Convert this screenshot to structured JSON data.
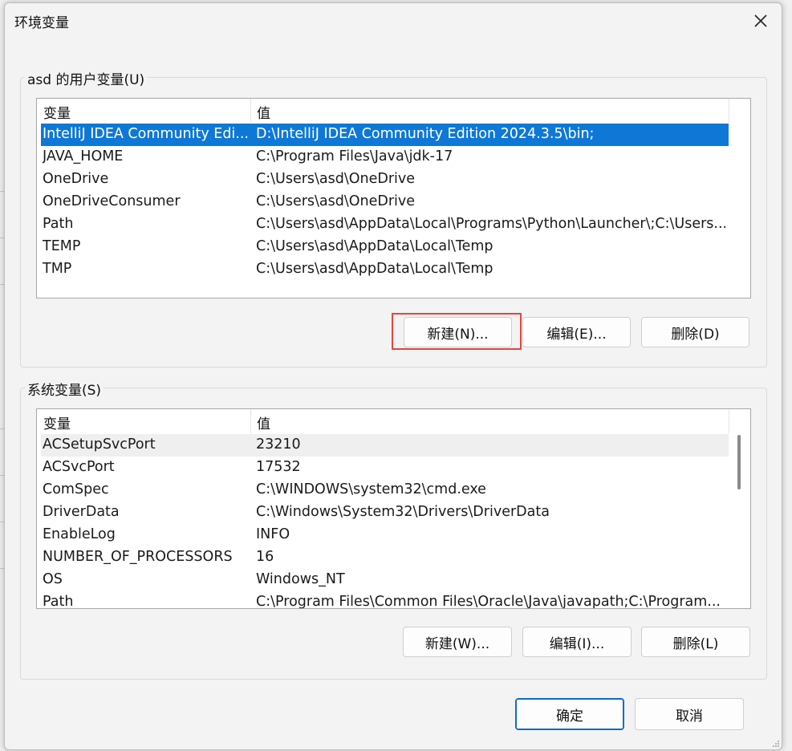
{
  "dialog": {
    "title": "环境变量",
    "close_icon": "close-icon"
  },
  "user_vars": {
    "group_label": "asd 的用户变量(U)",
    "col_name": "变量",
    "col_value": "值",
    "rows": [
      {
        "name": "IntelliJ IDEA Community Edi...",
        "value": "D:\\IntelliJ IDEA Community Edition 2024.3.5\\bin;"
      },
      {
        "name": "JAVA_HOME",
        "value": "C:\\Program Files\\Java\\jdk-17"
      },
      {
        "name": "OneDrive",
        "value": "C:\\Users\\asd\\OneDrive"
      },
      {
        "name": "OneDriveConsumer",
        "value": "C:\\Users\\asd\\OneDrive"
      },
      {
        "name": "Path",
        "value": "C:\\Users\\asd\\AppData\\Local\\Programs\\Python\\Launcher\\;C:\\Users..."
      },
      {
        "name": "TEMP",
        "value": "C:\\Users\\asd\\AppData\\Local\\Temp"
      },
      {
        "name": "TMP",
        "value": "C:\\Users\\asd\\AppData\\Local\\Temp"
      }
    ],
    "new_label": "新建(N)...",
    "edit_label": "编辑(E)...",
    "delete_label": "删除(D)"
  },
  "system_vars": {
    "group_label": "系统变量(S)",
    "col_name": "变量",
    "col_value": "值",
    "rows": [
      {
        "name": "ACSetupSvcPort",
        "value": "23210"
      },
      {
        "name": "ACSvcPort",
        "value": "17532"
      },
      {
        "name": "ComSpec",
        "value": "C:\\WINDOWS\\system32\\cmd.exe"
      },
      {
        "name": "DriverData",
        "value": "C:\\Windows\\System32\\Drivers\\DriverData"
      },
      {
        "name": "EnableLog",
        "value": "INFO"
      },
      {
        "name": "NUMBER_OF_PROCESSORS",
        "value": "16"
      },
      {
        "name": "OS",
        "value": "Windows_NT"
      },
      {
        "name": "Path",
        "value": "C:\\Program Files\\Common Files\\Oracle\\Java\\javapath;C:\\Program..."
      }
    ],
    "new_label": "新建(W)...",
    "edit_label": "编辑(I)...",
    "delete_label": "删除(L)"
  },
  "footer": {
    "ok_label": "确定",
    "cancel_label": "取消"
  },
  "colors": {
    "selection": "#0f78d7",
    "highlight_box": "#e0463f",
    "primary_border": "#0f6cbd"
  }
}
